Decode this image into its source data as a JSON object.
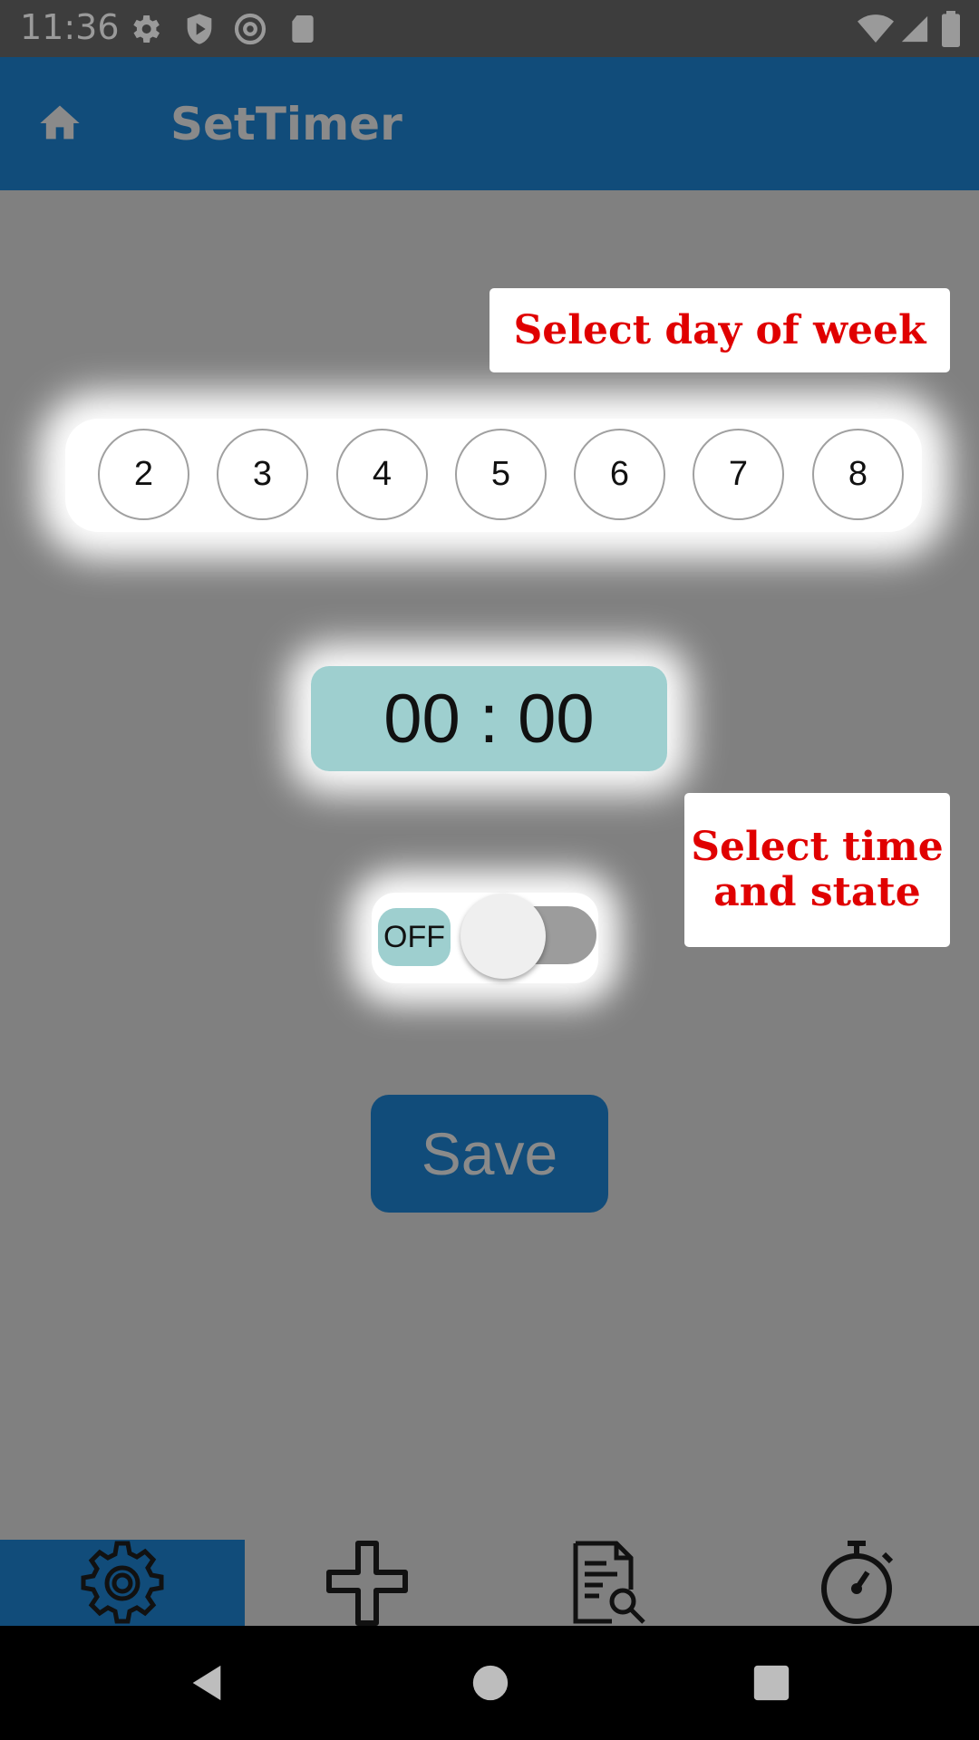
{
  "status_bar": {
    "time": "11:36"
  },
  "app_bar": {
    "title": "SetTimer"
  },
  "tooltips": {
    "day": "Select day of week",
    "time_line1": "Select time",
    "time_line2": "and state"
  },
  "days": [
    "2",
    "3",
    "4",
    "5",
    "6",
    "7",
    "8"
  ],
  "time": {
    "value": "00 : 00"
  },
  "toggle": {
    "state": "OFF",
    "checked": false
  },
  "save": {
    "label": "Save"
  },
  "bottom_nav": [
    "settings-icon",
    "add-icon",
    "search-document-icon",
    "stopwatch-icon"
  ],
  "colors": {
    "primary": "#114c7a",
    "accent": "#9ecfcf",
    "tooltip_text": "#e00000"
  }
}
